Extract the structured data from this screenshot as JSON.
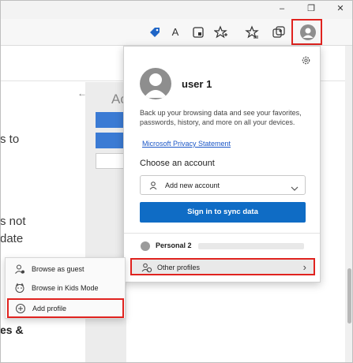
{
  "window": {
    "minimize": "–",
    "restore": "❐",
    "close": "✕"
  },
  "toolbar": {
    "icons": [
      "tag-icon",
      "read-aloud-icon",
      "tab-icon",
      "favorites-add-icon",
      "favorites-icon",
      "collections-icon",
      "profile-icon"
    ],
    "read_aloud_text": "A",
    "colors": {
      "tag": "#1f65c6"
    }
  },
  "page": {
    "text_fragments": [
      "s to",
      "s not",
      "date",
      "es &"
    ],
    "partial_heading": "Ac",
    "back_arrow": "←"
  },
  "profile_popup": {
    "user_name": "user 1",
    "backup_text": "Back up your browsing data and see your favorites, passwords, history, and more on all your devices.",
    "privacy_link": "Microsoft Privacy Statement",
    "choose_account_label": "Choose an account",
    "add_new_account": "Add new account",
    "sync_button": "Sign in to sync data",
    "personal_profile": "Personal 2",
    "other_profiles": "Other profiles",
    "chevron": "›",
    "colors": {
      "sync_button": "#0f6cc5",
      "link": "#1a56c7",
      "highlight": "#e0231f"
    }
  },
  "other_profiles_menu": {
    "items": [
      {
        "label": "Browse as guest",
        "icon": "guest-icon"
      },
      {
        "label": "Browse in Kids Mode",
        "icon": "kids-mode-icon"
      },
      {
        "label": "Add profile",
        "icon": "add-circle-icon"
      }
    ]
  }
}
